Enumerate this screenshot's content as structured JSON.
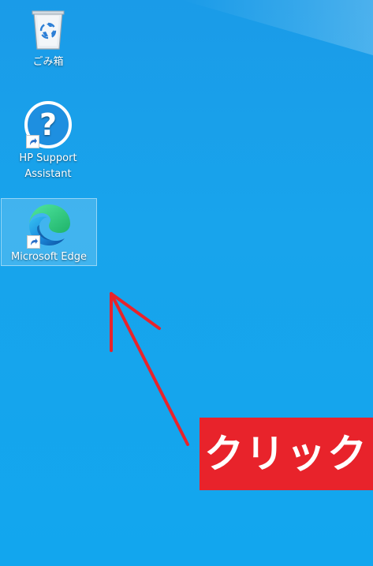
{
  "desktop": {
    "background_color": "#18a4ec",
    "icons": [
      {
        "label": "ごみ箱",
        "icon": "recycle-bin-icon"
      },
      {
        "label_line1": "HP Support",
        "label_line2": "Assistant",
        "icon": "help-question-icon",
        "shortcut": true
      },
      {
        "label": "Microsoft Edge",
        "icon": "microsoft-edge-icon",
        "shortcut": true,
        "selected": true
      }
    ]
  },
  "annotation": {
    "text": "クリック",
    "color": "#e8232b",
    "arrow_icon": "red-arrow-icon"
  }
}
